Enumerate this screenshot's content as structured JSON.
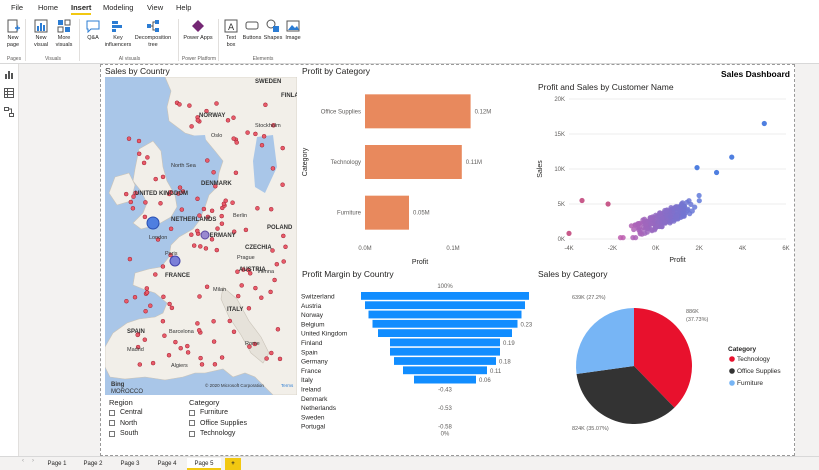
{
  "menu": {
    "file": "File",
    "home": "Home",
    "insert": "Insert",
    "modeling": "Modeling",
    "view": "View",
    "help": "Help"
  },
  "ribbon": {
    "new_page": "New page",
    "new_visual": "New visual",
    "more_visuals": "More visuals",
    "qa": "Q&A",
    "key_influencers": "Key influencers",
    "decomposition_tree": "Decomposition tree",
    "power_apps": "Power Apps",
    "text_box": "Text box",
    "buttons": "Buttons",
    "shapes": "Shapes",
    "image": "Image",
    "group_pages": "Pages",
    "group_visuals": "Visuals",
    "group_ai_visuals": "AI visuals",
    "group_power_platform": "Power Platform",
    "group_elements": "Elements"
  },
  "dashboard_title": "Sales Dashboard",
  "map": {
    "title": "Sales by Country",
    "countries": [
      "SWEDEN",
      "NORWAY",
      "FINLAND",
      "UNITED KINGDOM",
      "DENMARK",
      "NETHERLANDS",
      "GERMANY",
      "POLAND",
      "CZECHIA",
      "AUSTRIA",
      "FRANCE",
      "ITALY",
      "SPAIN",
      "North Sea",
      "Oslo",
      "Stockholm",
      "London",
      "Paris",
      "Rome",
      "Madrid",
      "Algiers",
      "Barcelona",
      "Berlin",
      "Prague",
      "Vienna",
      "Milan"
    ],
    "copyright": "© 2020 Microsoft Corporation",
    "terms": "Terms",
    "bing": "Bing",
    "morocco": "MOROCCO"
  },
  "slicers": {
    "region": {
      "title": "Region",
      "items": [
        "Central",
        "North",
        "South"
      ]
    },
    "category": {
      "title": "Category",
      "items": [
        "Furniture",
        "Office Supplies",
        "Technology"
      ]
    }
  },
  "profit_by_category": {
    "title": "Profit by Category",
    "xlabel": "Profit",
    "ylabel": "Category",
    "xticks": [
      "0.0M",
      "0.1M"
    ],
    "categories": [
      "Office Supplies",
      "Technology",
      "Furniture"
    ],
    "values": [
      0.12,
      0.11,
      0.05
    ],
    "labels": [
      "0.12M",
      "0.11M",
      "0.05M"
    ],
    "color": "#e8895d"
  },
  "scatter": {
    "title": "Profit and Sales by Customer Name",
    "xlabel": "Profit",
    "ylabel": "Sales",
    "xticks": [
      "-4K",
      "-2K",
      "0K",
      "2K",
      "4K",
      "6K"
    ],
    "yticks": [
      "0K",
      "5K",
      "10K",
      "15K",
      "20K"
    ]
  },
  "funnel": {
    "title": "Profit Margin by Country",
    "top_label": "100%",
    "bottom_label": "0%",
    "countries": [
      "Switzerland",
      "Austria",
      "Norway",
      "Belgium",
      "United Kingdom",
      "Finland",
      "Spain",
      "Germany",
      "France",
      "Italy",
      "Ireland",
      "Denmark",
      "Netherlands",
      "Sweden",
      "Portugal"
    ],
    "labels": [
      "",
      "",
      "",
      "0.23",
      "",
      "0.19",
      "",
      "0.18",
      "0.11",
      "0.06",
      "-0.43",
      "",
      "-0.53",
      "",
      "-0.58"
    ],
    "color": "#118dff"
  },
  "pie": {
    "title": "Sales by Category",
    "legend_title": "Category",
    "legend": [
      "Technology",
      "Office Supplies",
      "Furniture"
    ],
    "colors": [
      "#e8112d",
      "#333333",
      "#77b5f5"
    ],
    "labels": [
      "886K (37.73%)",
      "824K (35.07%)",
      "639K (27.2%)"
    ],
    "label_tech_1": "886K",
    "label_tech_2": "(37.73%)",
    "label_office": "824K (35.07%)",
    "label_furn": "639K (27.2%)"
  },
  "pages": [
    "Page 1",
    "Page 2",
    "Page 3",
    "Page 4",
    "Page 5"
  ],
  "add_page": "+"
}
